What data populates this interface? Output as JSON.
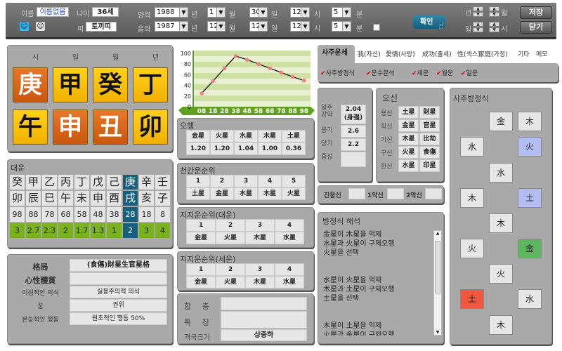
{
  "topbar": {
    "name_label": "이름",
    "name_value": "이름없음",
    "age_label": "나이",
    "age_value": "36세",
    "zodiac_label": "띠",
    "zodiac_value": "토끼띠",
    "solar_label": "양력",
    "lunar_label": "음력",
    "solar": {
      "year": "1988",
      "month": "1",
      "day": "30",
      "hour": "12",
      "minute": "5"
    },
    "lunar": {
      "year": "1987",
      "month": "12",
      "day": "12",
      "hour": "12",
      "minute": "5"
    },
    "unit_year": "년",
    "unit_month": "월",
    "unit_day": "일",
    "unit_hour": "시",
    "unit_minute": "분",
    "confirm_label": "확인",
    "save_label": "저장",
    "close_label": "닫기",
    "spin_year": "년",
    "spin_month": "월",
    "spin_day": "일",
    "spin_hour": "시"
  },
  "pillars": {
    "headers": [
      "시",
      "일",
      "월",
      "년"
    ],
    "stems": [
      {
        "char": "庚",
        "color": "orange"
      },
      {
        "char": "甲",
        "color": "yellow"
      },
      {
        "char": "癸",
        "color": "yellow"
      },
      {
        "char": "丁",
        "color": "yellow"
      }
    ],
    "branches": [
      {
        "char": "午",
        "color": "yellow"
      },
      {
        "char": "申",
        "color": "orange"
      },
      {
        "char": "丑",
        "color": "orange"
      },
      {
        "char": "卯",
        "color": "yellow"
      }
    ]
  },
  "daewoon": {
    "title": "대운",
    "stems": [
      "癸",
      "甲",
      "乙",
      "丙",
      "丁",
      "戊",
      "己",
      "庚",
      "辛",
      "壬"
    ],
    "branches": [
      "卯",
      "辰",
      "巳",
      "午",
      "未",
      "申",
      "酉",
      "戌",
      "亥",
      "子"
    ],
    "ages": [
      "98",
      "88",
      "78",
      "68",
      "58",
      "48",
      "38",
      "28",
      "18",
      "8"
    ],
    "scores": [
      "3",
      "2.7",
      "2.3",
      "2",
      "1.7",
      "1.3",
      "1",
      "2",
      "3",
      "4"
    ],
    "selected_index": 7
  },
  "gyeokguk": {
    "rows": [
      {
        "label": "格局",
        "value": "(食傷)財星生官星格"
      },
      {
        "label": "心性體質",
        "value": ""
      },
      {
        "label": "이성적인 의식",
        "value": "실용주의적 의식"
      },
      {
        "label": "꿈",
        "value": "권위"
      },
      {
        "label": "본능적인 행동",
        "value": "원초적인 행동 50%"
      }
    ]
  },
  "chart_data": {
    "type": "line",
    "categories": [
      "08",
      "18",
      "28",
      "38",
      "48",
      "58",
      "68",
      "78",
      "88",
      "98"
    ],
    "values": [
      25,
      48,
      72,
      95,
      88,
      80,
      72,
      64,
      56,
      49
    ],
    "yticks": [
      "0",
      "20",
      "40",
      "60",
      "80",
      "100"
    ],
    "ylim": [
      0,
      100
    ],
    "grid": true,
    "line_color": "#111111",
    "marker_color": "#f08080",
    "band_colors": [
      "#cfe0a4",
      "#e8f0d2"
    ]
  },
  "ohaeng": {
    "title": "오행",
    "names": [
      "金星",
      "火星",
      "水星",
      "木星",
      "土星"
    ],
    "values": [
      "1.20",
      "1.20",
      "1.04",
      "1.00",
      "0.36"
    ]
  },
  "cheongan": {
    "title": "천간운순위",
    "ranks": [
      "1",
      "2",
      "3",
      "4",
      "5"
    ],
    "names": [
      "土星",
      "金星",
      "水星",
      "木星",
      "火星"
    ]
  },
  "jiji_dw": {
    "title": "지지운순위(대운)",
    "ranks": [
      "1",
      "2",
      "3",
      "4"
    ],
    "names": [
      "金星",
      "火星",
      "木星",
      "水星"
    ]
  },
  "jiji_sw": {
    "title": "지지운순위(세운)",
    "ranks": [
      "1",
      "2",
      "3",
      "4"
    ],
    "names": [
      "金星",
      "火星",
      "木星",
      "水星"
    ]
  },
  "hapchung": {
    "hap_label": "합  충",
    "feature_label": "특  징",
    "size_label": "격국크기",
    "hap_value": "",
    "feature_value": "",
    "size_value": "상중하"
  },
  "tabs": {
    "items": [
      "사주운세",
      "我(자신)",
      "愛情(사랑)",
      "成功(출세)",
      "性(섹스)",
      "家庭(가정)",
      "기타",
      "메모"
    ],
    "active": 0,
    "checks": [
      "사주방정식",
      "운수분석",
      "세운",
      "월운",
      "일운"
    ]
  },
  "strength": {
    "rows": [
      {
        "label": "일주\n강약",
        "value": "2.04\n(身强)"
      },
      {
        "label": "음기",
        "value": "2.6"
      },
      {
        "label": "양기",
        "value": "2.2"
      },
      {
        "label": "중성",
        "value": ""
      }
    ]
  },
  "osin": {
    "title": "오신",
    "rows": [
      {
        "label": "용신",
        "a": "土星",
        "b": "財星"
      },
      {
        "label": "희신",
        "a": "金星",
        "b": "官星"
      },
      {
        "label": "기신",
        "a": "木星",
        "b": "比劫"
      },
      {
        "label": "구신",
        "a": "火星",
        "b": "食傷"
      },
      {
        "label": "한신",
        "a": "水星",
        "b": "印星"
      }
    ]
  },
  "yongsin": {
    "labels": [
      "진용신",
      "1악신",
      "2악신"
    ],
    "values": [
      "",
      "",
      ""
    ]
  },
  "interpretation": {
    "title": "방정식 해석",
    "lines": [
      "金星이 木星을 억제",
      "水星과 火星이 구제오행",
      "火星을 선택",
      "",
      "",
      "水星이 火星을 억제",
      "木星과 土星이 구제오행",
      "土星을 선택",
      "",
      "",
      "木星이 土星을 억제",
      "火星과 金星이 구제오행"
    ]
  },
  "equation": {
    "title": "사주방정식",
    "boxes": [
      {
        "char": "金",
        "col": 1,
        "row": 0,
        "color": ""
      },
      {
        "char": "木",
        "col": 2,
        "row": 0,
        "color": ""
      },
      {
        "char": "水",
        "col": 0,
        "row": 1,
        "color": ""
      },
      {
        "char": "火",
        "col": 2,
        "row": 1,
        "color": "#b3bdf2"
      },
      {
        "char": "水",
        "col": 1,
        "row": 2,
        "color": ""
      },
      {
        "char": "木",
        "col": 0,
        "row": 3,
        "color": ""
      },
      {
        "char": "土",
        "col": 2,
        "row": 3,
        "color": "#b3bdf2"
      },
      {
        "char": "木",
        "col": 1,
        "row": 4,
        "color": ""
      },
      {
        "char": "火",
        "col": 0,
        "row": 5,
        "color": ""
      },
      {
        "char": "金",
        "col": 2,
        "row": 5,
        "color": "#5cb85c"
      },
      {
        "char": "火",
        "col": 1,
        "row": 6,
        "color": ""
      },
      {
        "char": "土",
        "col": 0,
        "row": 7,
        "color": "#f0573f"
      },
      {
        "char": "水",
        "col": 2,
        "row": 7,
        "color": ""
      },
      {
        "char": "木",
        "col": 1,
        "row": 8,
        "color": ""
      }
    ]
  }
}
